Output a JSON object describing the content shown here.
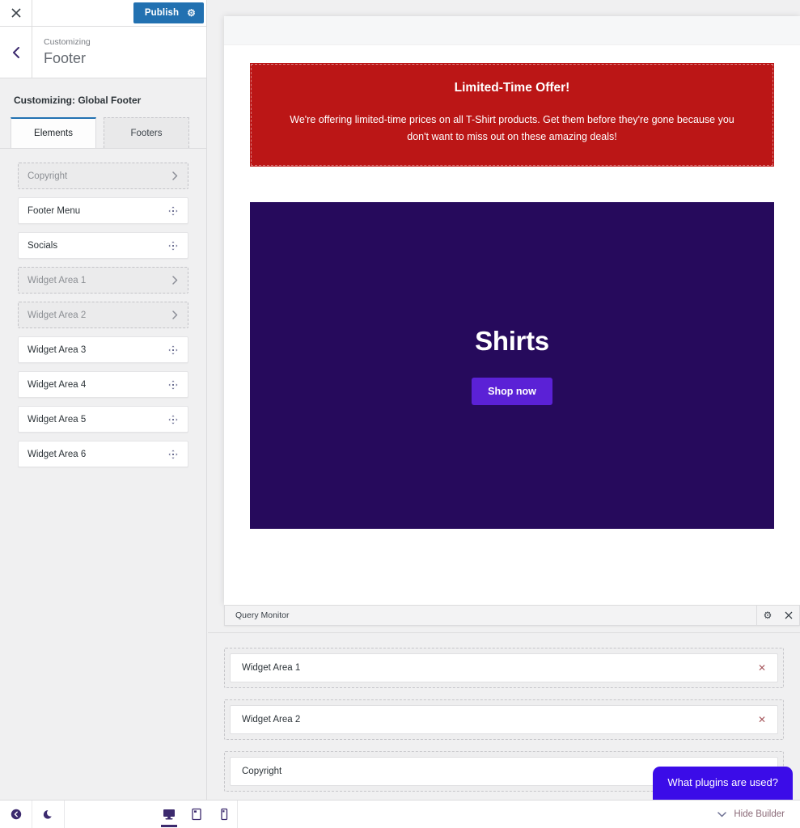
{
  "sidebar": {
    "topbar": {
      "close_icon": "close-icon",
      "publish_label": "Publish",
      "publish_gear_icon": "gear-icon"
    },
    "header": {
      "back_icon": "chevron-left-icon",
      "eyebrow": "Customizing",
      "title": "Footer"
    },
    "section_title": "Customizing: Global Footer",
    "tabs": [
      {
        "label": "Elements",
        "active": true
      },
      {
        "label": "Footers",
        "active": false
      }
    ],
    "items": [
      {
        "label": "Copyright",
        "state": "ghost",
        "icon": "chevron-right-icon"
      },
      {
        "label": "Footer Menu",
        "state": "solid",
        "icon": "move-icon"
      },
      {
        "label": "Socials",
        "state": "solid",
        "icon": "move-icon"
      },
      {
        "label": "Widget Area 1",
        "state": "ghost",
        "icon": "chevron-right-icon"
      },
      {
        "label": "Widget Area 2",
        "state": "ghost",
        "icon": "chevron-right-icon"
      },
      {
        "label": "Widget Area 3",
        "state": "solid",
        "icon": "move-icon"
      },
      {
        "label": "Widget Area 4",
        "state": "solid",
        "icon": "move-icon"
      },
      {
        "label": "Widget Area 5",
        "state": "solid",
        "icon": "move-icon"
      },
      {
        "label": "Widget Area 6",
        "state": "solid",
        "icon": "move-icon"
      }
    ]
  },
  "preview": {
    "promo": {
      "title": "Limited-Time Offer!",
      "text": "We're offering limited-time prices on all T-Shirt products. Get them before they're gone because you don't want to miss out on these amazing deals!",
      "background": "#bb1616"
    },
    "hero": {
      "title": "Shirts",
      "button_label": "Shop now",
      "background": "#260a5c",
      "button_color": "#5b21d6"
    },
    "chat_badge": {
      "label": "What plugins are used?",
      "color": "#3b0ce8"
    },
    "query_monitor": {
      "label": "Query Monitor",
      "gear_icon": "gear-icon",
      "close_icon": "close-icon"
    }
  },
  "builder": {
    "rows": [
      {
        "label": "Widget Area 1",
        "remove_icon": "close-icon"
      },
      {
        "label": "Widget Area 2",
        "remove_icon": "close-icon"
      },
      {
        "label": "Copyright",
        "remove_icon": "close-icon"
      }
    ]
  },
  "bottombar": {
    "collapse_icon": "collapse-circle-icon",
    "dark_mode_icon": "moon-icon",
    "devices": [
      {
        "name": "desktop-icon",
        "active": true
      },
      {
        "name": "tablet-icon",
        "active": false
      },
      {
        "name": "mobile-icon",
        "active": false
      }
    ],
    "hide_builder_label": "Hide Builder",
    "hide_builder_icon": "chevron-down-icon"
  },
  "colors": {
    "accent_blue": "#2271b1",
    "promo_red": "#bb1616",
    "hero_purple": "#260a5c",
    "button_purple": "#5b21d6",
    "chat_blue": "#3b0ce8"
  }
}
